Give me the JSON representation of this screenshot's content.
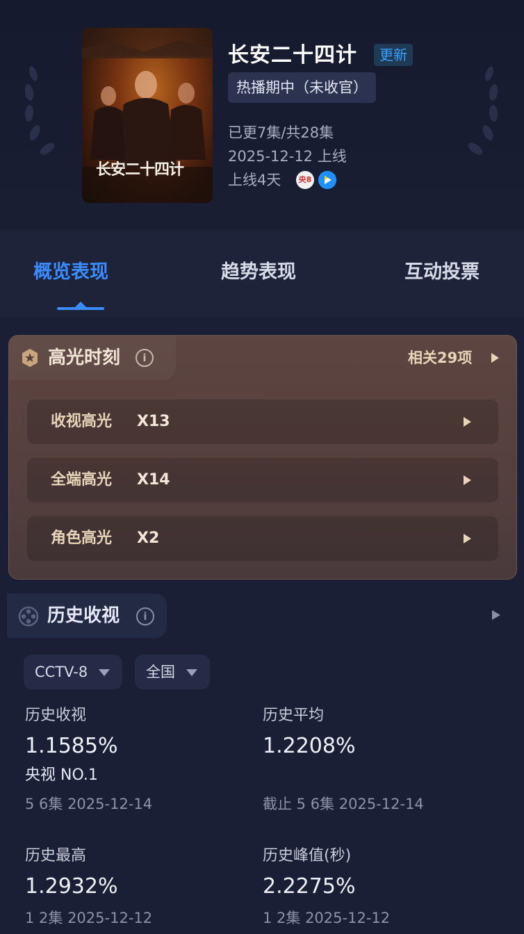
{
  "drama": {
    "title": "长安二十四计",
    "update_badge": "更新",
    "status": "热播期中（未收官）",
    "episodes": "已更7集/共28集",
    "release": "2025-12-12 上线",
    "days_online": "上线4天",
    "poster_caption": "长安二十四计",
    "platforms": [
      "CCTV-8",
      "Youku"
    ]
  },
  "tabs": [
    {
      "label": "概览表现",
      "active": true
    },
    {
      "label": "趋势表现",
      "active": false
    },
    {
      "label": "互动投票",
      "active": false
    }
  ],
  "highlights": {
    "title": "高光时刻",
    "related": "相关29项",
    "items": [
      {
        "label": "收视高光",
        "count": "X13"
      },
      {
        "label": "全端高光",
        "count": "X14"
      },
      {
        "label": "角色高光",
        "count": "X2"
      }
    ]
  },
  "history": {
    "title": "历史收视",
    "filters": {
      "channel": "CCTV-8",
      "region": "全国"
    },
    "stats": {
      "history_rating": {
        "label": "历史收视",
        "value": "1.1585%",
        "rank": "央视 NO.1",
        "sub": "5 6集 2025-12-14"
      },
      "history_average": {
        "label": "历史平均",
        "value": "1.2208%",
        "sub": "截止 5 6集 2025-12-14"
      },
      "history_high": {
        "label": "历史最高",
        "value": "1.2932%",
        "sub": "1 2集 2025-12-12"
      },
      "history_peak": {
        "label": "历史峰值(秒)",
        "value": "2.2275%",
        "sub": "1 2集 2025-12-12"
      }
    }
  },
  "colors": {
    "background": "#1b1f35",
    "accent": "#3a8cff",
    "highlight_card": "#55403e",
    "highlight_text": "#e8d4b8"
  }
}
